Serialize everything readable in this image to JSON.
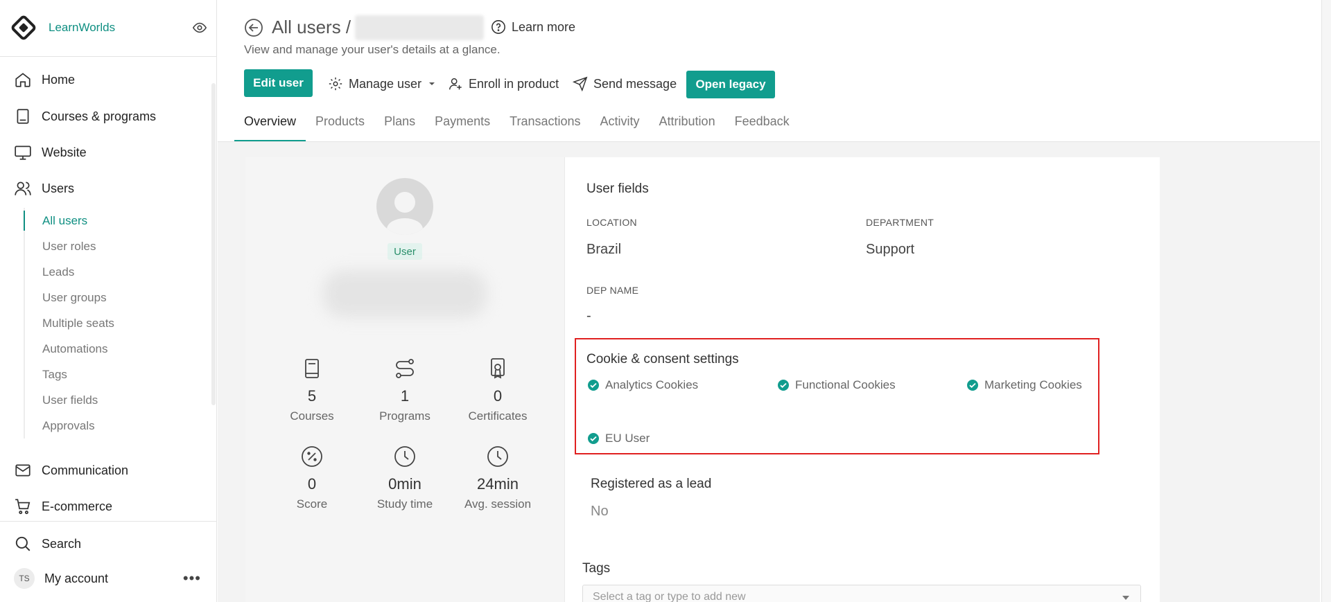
{
  "sidebar": {
    "brand": "LearnWorlds",
    "nav": {
      "home": "Home",
      "courses": "Courses & programs",
      "website": "Website",
      "users": "Users",
      "communication": "Communication",
      "ecommerce": "E-commerce",
      "search": "Search"
    },
    "users_sub": [
      "All users",
      "User roles",
      "Leads",
      "User groups",
      "Multiple seats",
      "Automations",
      "Tags",
      "User fields",
      "Approvals"
    ],
    "account": {
      "initials": "TS",
      "label": "My account",
      "more": "•••"
    }
  },
  "header": {
    "title": "All users /",
    "learn_more": "Learn more",
    "subtitle": "View and manage your user's details at a glance."
  },
  "actions": {
    "edit_user": "Edit user",
    "manage_user": "Manage user",
    "enroll": "Enroll in product",
    "send_message": "Send message",
    "open_legacy": "Open legacy"
  },
  "tabs": [
    "Overview",
    "Products",
    "Plans",
    "Payments",
    "Transactions",
    "Activity",
    "Attribution",
    "Feedback"
  ],
  "profile": {
    "role": "User",
    "stats": [
      {
        "value": "5",
        "label": "Courses"
      },
      {
        "value": "1",
        "label": "Programs"
      },
      {
        "value": "0",
        "label": "Certificates"
      },
      {
        "value": "0",
        "label": "Score"
      },
      {
        "value": "0min",
        "label": "Study time"
      },
      {
        "value": "24min",
        "label": "Avg. session"
      }
    ]
  },
  "user_fields": {
    "title": "User fields",
    "location_label": "LOCATION",
    "location_value": "Brazil",
    "department_label": "DEPARTMENT",
    "department_value": "Support",
    "dep_name_label": "DEP NAME",
    "dep_name_value": "-"
  },
  "consent": {
    "title": "Cookie & consent settings",
    "items": [
      "Analytics Cookies",
      "Functional Cookies",
      "Marketing Cookies",
      "EU User"
    ]
  },
  "lead": {
    "title": "Registered as a lead",
    "value": "No"
  },
  "tags": {
    "title": "Tags",
    "placeholder": "Select a tag or type to add new"
  },
  "colors": {
    "accent": "#119d8e",
    "highlight_border": "#e02020"
  }
}
